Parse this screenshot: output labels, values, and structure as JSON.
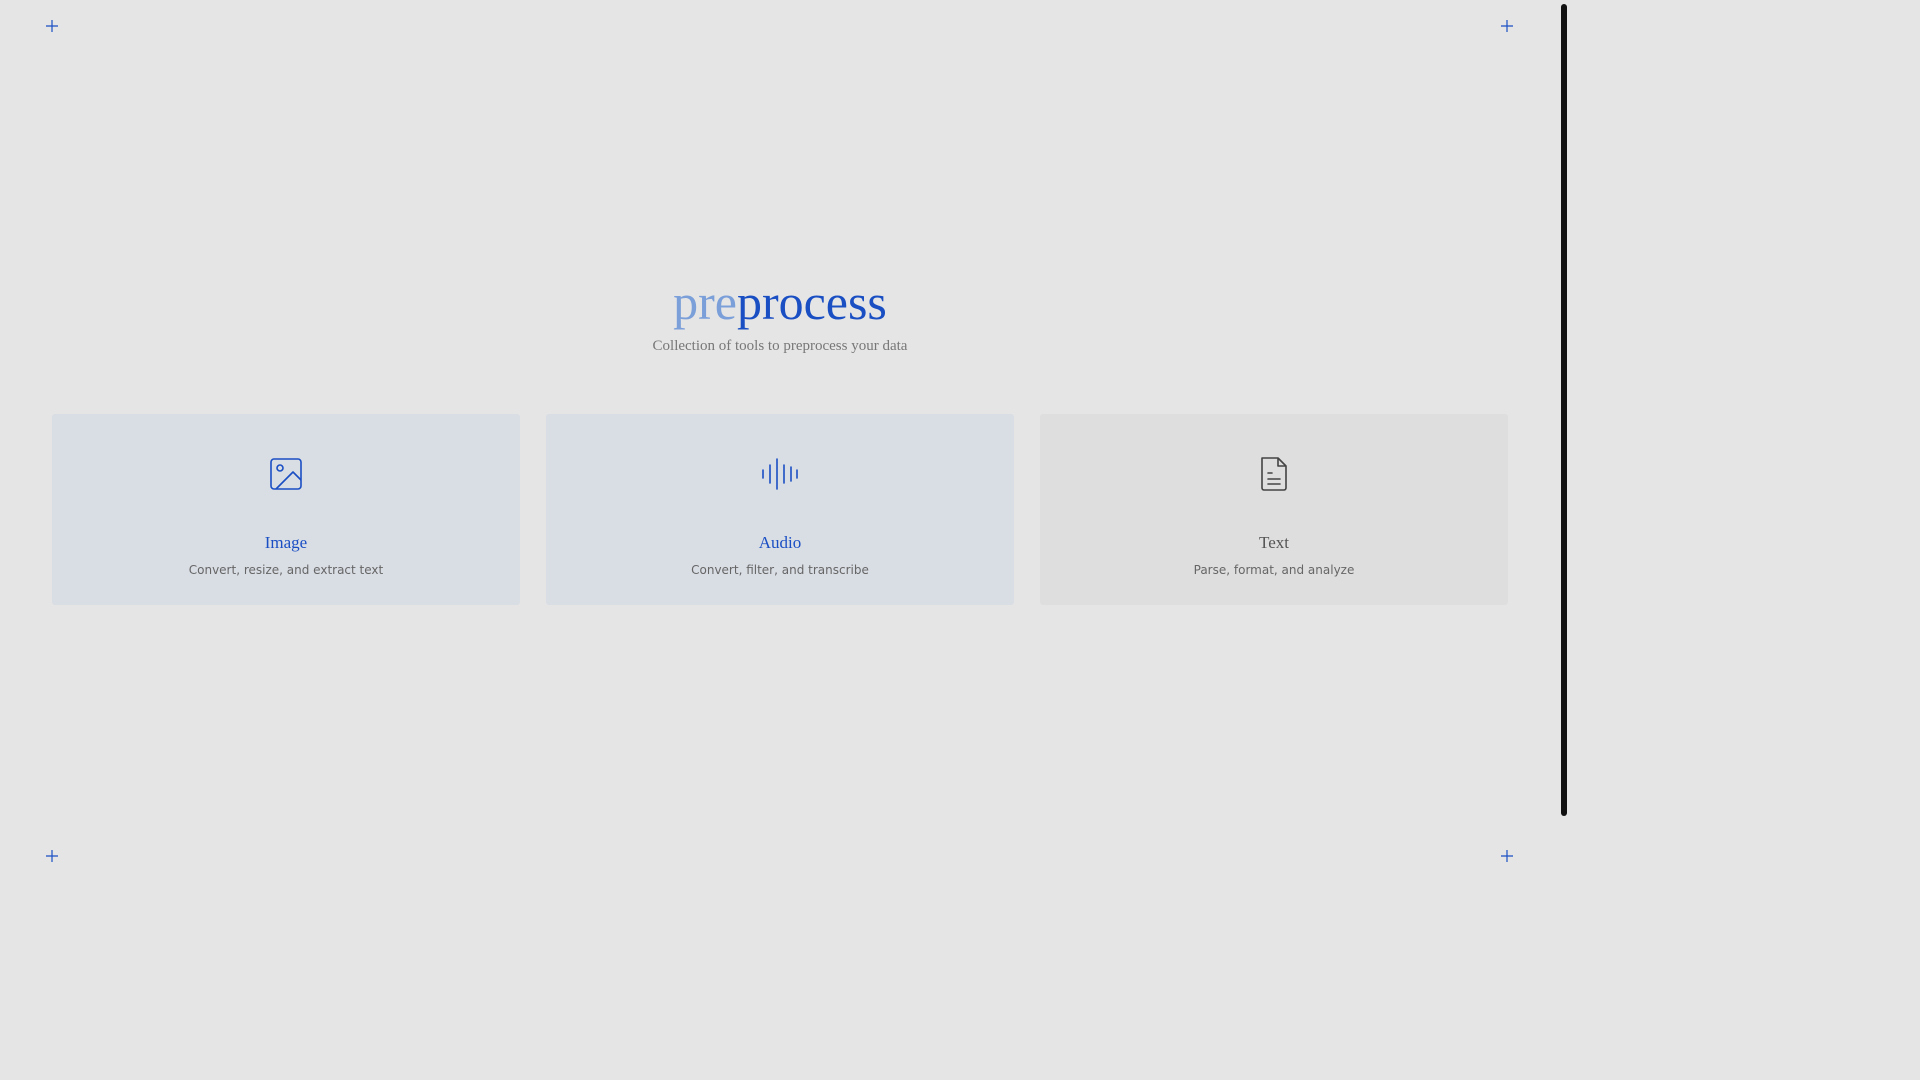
{
  "app": {
    "title_prefix": "pre",
    "title_suffix": "process",
    "subtitle": "Collection of tools to preprocess your data"
  },
  "colors": {
    "background": "#e5e5e5",
    "accent": "#1a4fc4",
    "accent_light": "#7b9fd9",
    "card_blue": "#d9dde4",
    "card_grey": "#dedede"
  },
  "cards": [
    {
      "title": "Image",
      "description": "Convert, resize, and extract text",
      "icon": "image-icon"
    },
    {
      "title": "Audio",
      "description": "Convert, filter, and transcribe",
      "icon": "audio-waveform-icon"
    },
    {
      "title": "Text",
      "description": "Parse, format, and analyze",
      "icon": "document-text-icon"
    }
  ],
  "decor": {
    "corner_icon": "plus-icon"
  }
}
